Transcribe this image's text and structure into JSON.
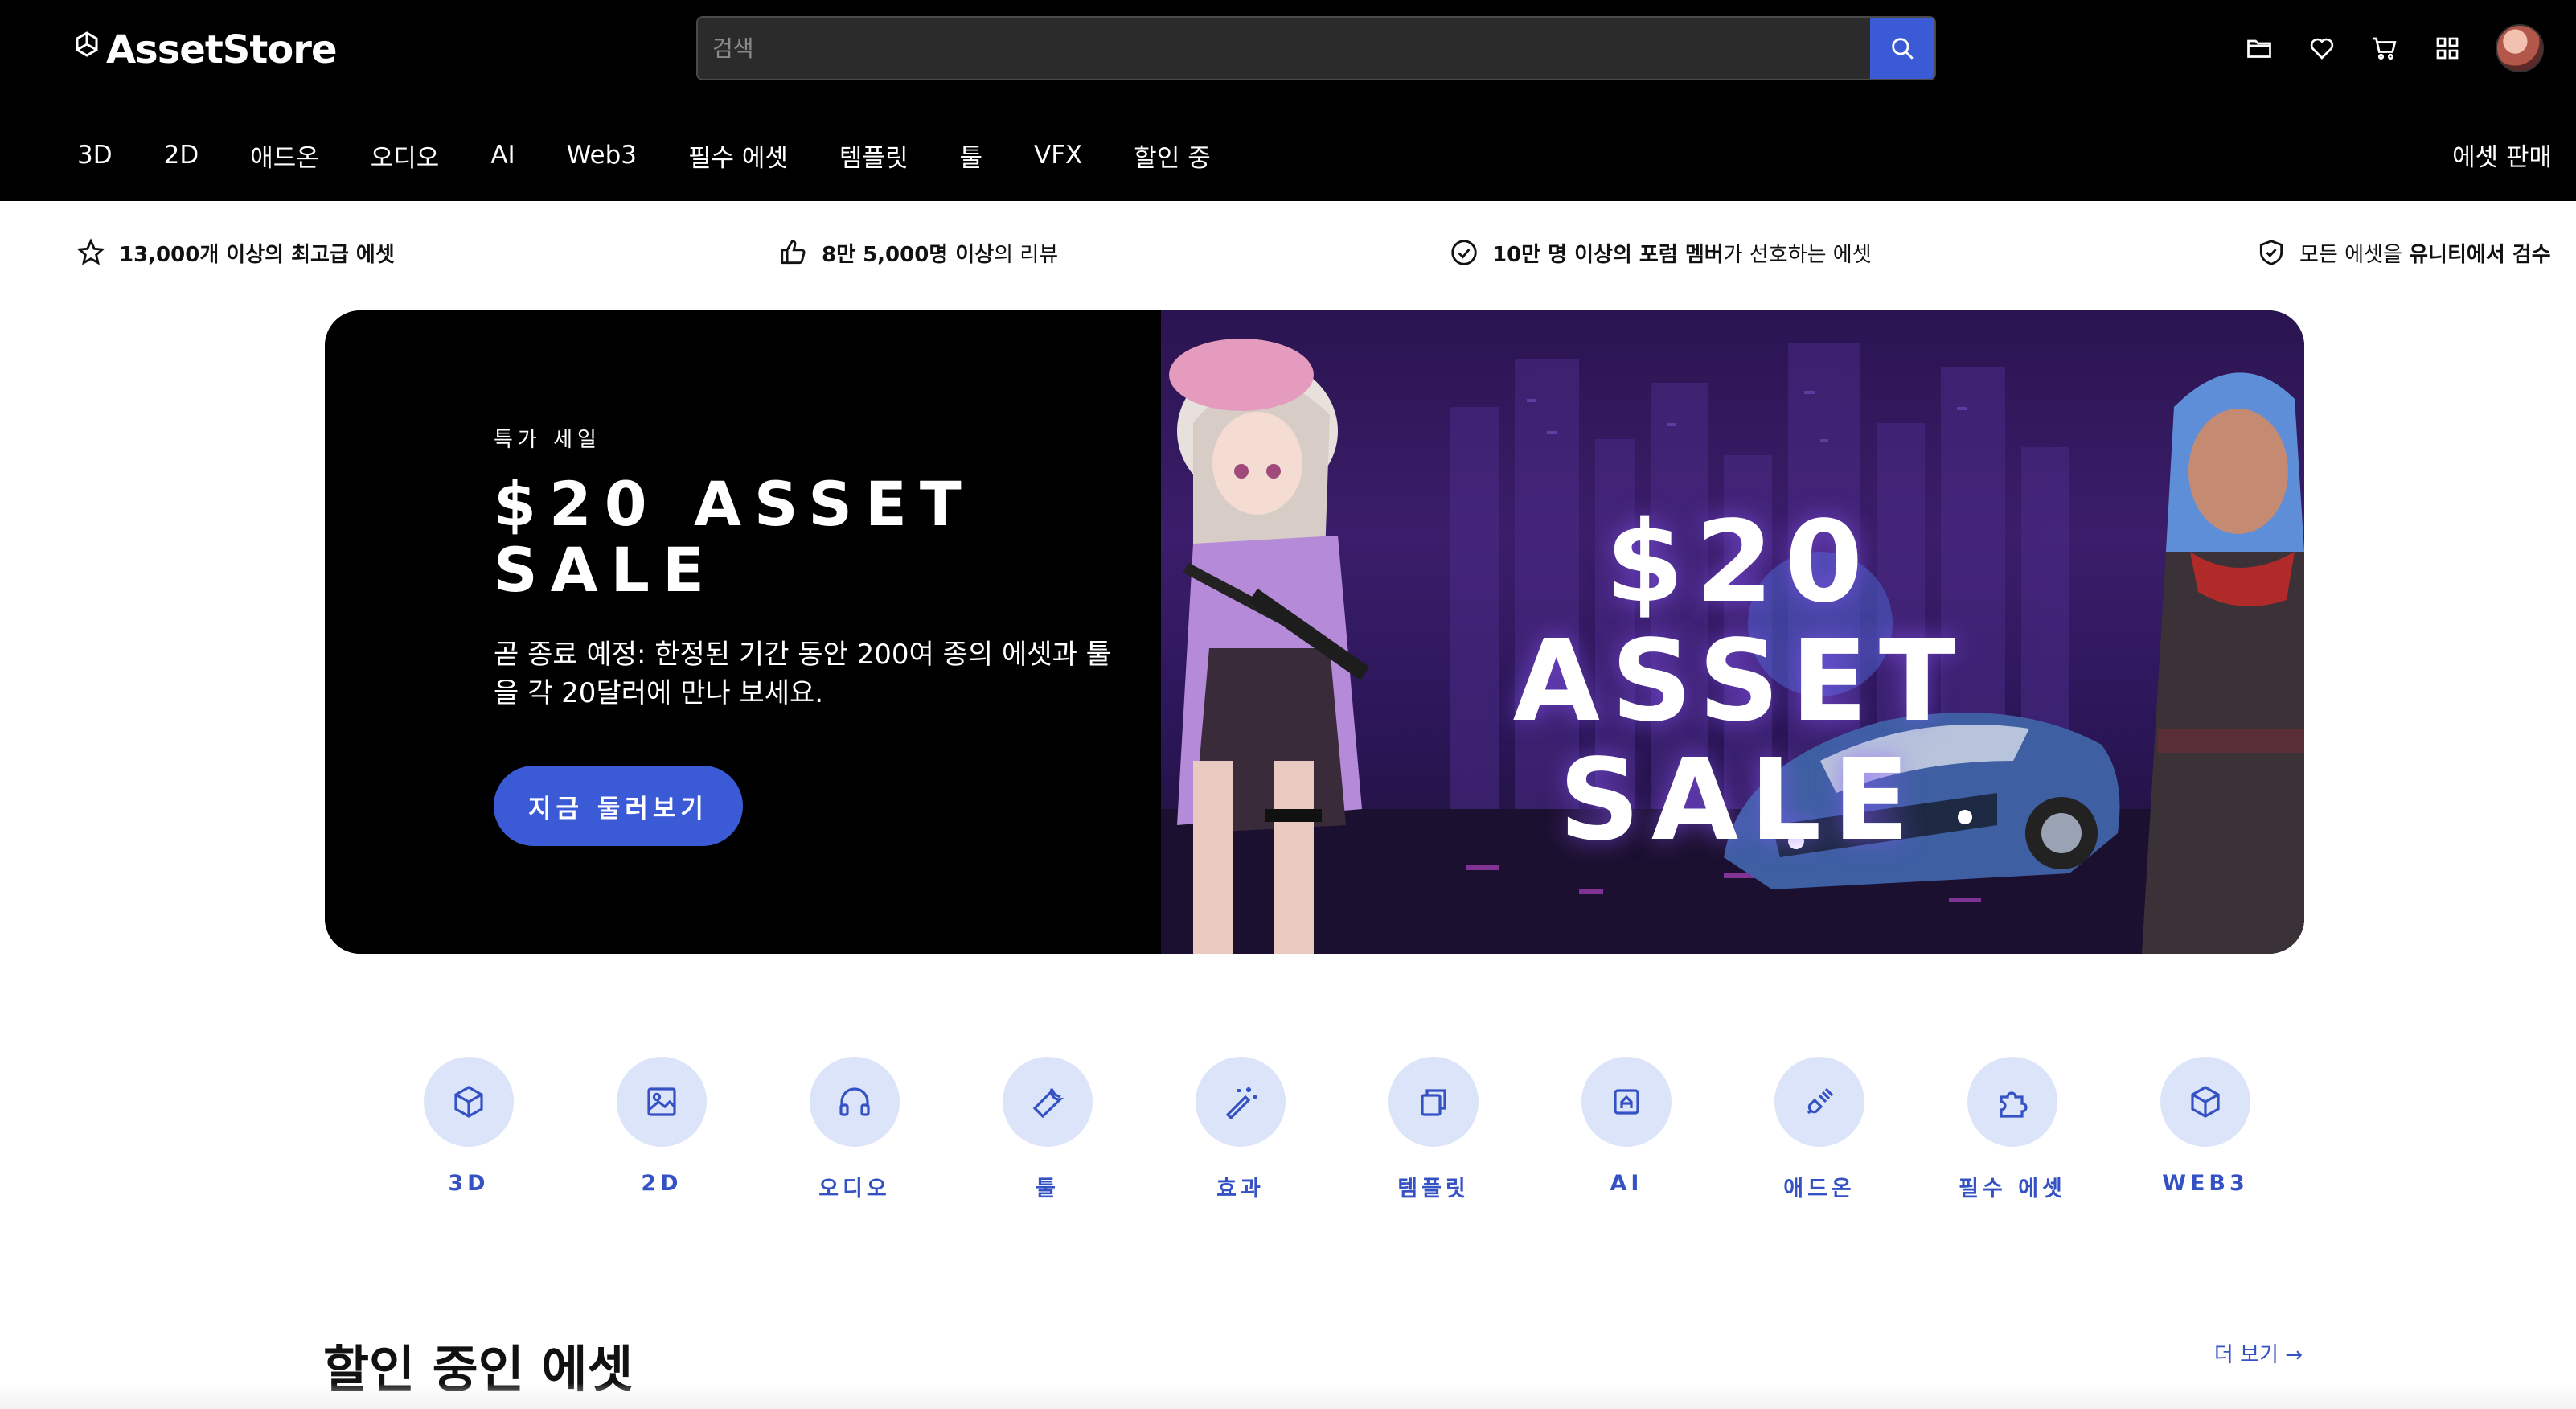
{
  "brand": {
    "logo_text": "AssetStore"
  },
  "search": {
    "placeholder": "검색"
  },
  "top_icons": [
    "folder-icon",
    "heart-icon",
    "cart-icon",
    "grid-icon"
  ],
  "nav": {
    "items": [
      "3D",
      "2D",
      "애드온",
      "오디오",
      "AI",
      "Web3",
      "필수 에셋",
      "템플릿",
      "툴",
      "VFX",
      "할인 중"
    ],
    "sell_label": "에셋 판매"
  },
  "trust": [
    {
      "strong": "13,000개 이상의 최고급 에셋",
      "rest": ""
    },
    {
      "strong": "8만 5,000명 이상",
      "rest": "의 리뷰"
    },
    {
      "strong": "10만 명 이상의 포럼 멤버",
      "rest": "가 선호하는 에셋"
    },
    {
      "pre": "모든 에셋을 ",
      "strong": "유니티에서 검수"
    }
  ],
  "hero": {
    "eyebrow": "특가 세일",
    "title": "$20 ASSET SALE",
    "description": "곧 종료 예정: 한정된 기간 동안 200여 종의 에셋과 툴을 각 20달러에 만나 보세요.",
    "cta": "지금 둘러보기",
    "art_title": "$20 ASSET SALE"
  },
  "categories": [
    {
      "label": "3D",
      "icon": "cube-icon"
    },
    {
      "label": "2D",
      "icon": "image-icon"
    },
    {
      "label": "오디오",
      "icon": "headphones-icon"
    },
    {
      "label": "툴",
      "icon": "wrench-icon"
    },
    {
      "label": "효과",
      "icon": "magic-wand-icon"
    },
    {
      "label": "템플릿",
      "icon": "template-icon"
    },
    {
      "label": "AI",
      "icon": "ai-chip-icon"
    },
    {
      "label": "애드온",
      "icon": "plug-icon"
    },
    {
      "label": "필수 에셋",
      "icon": "puzzle-icon"
    },
    {
      "label": "WEB3",
      "icon": "web3-cube-icon"
    }
  ],
  "section": {
    "title": "할인 중인 에셋",
    "more": "더 보기 →"
  },
  "colors": {
    "accent": "#3b5bd6",
    "header_bg": "#000000",
    "category_circle": "#dbe4f9",
    "category_text": "#3552c4"
  }
}
